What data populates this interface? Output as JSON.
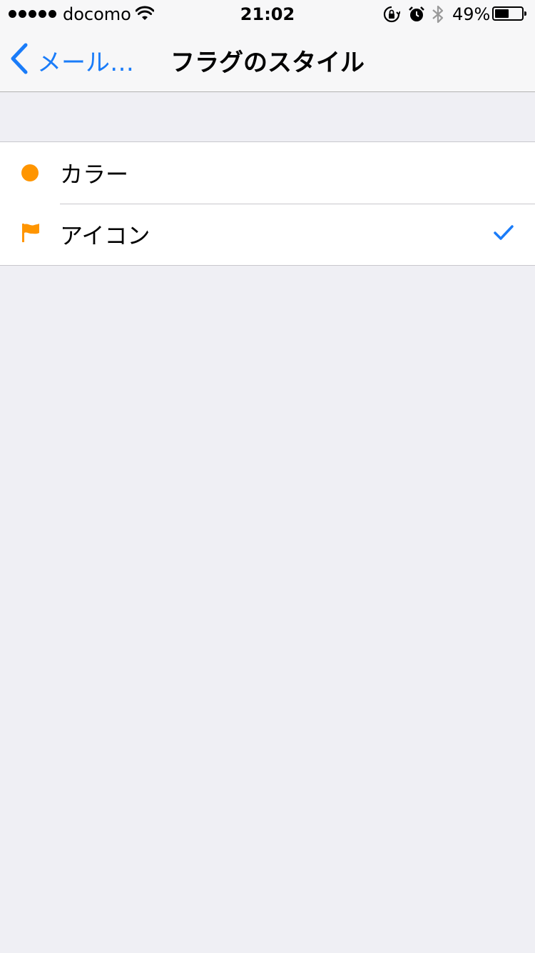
{
  "status_bar": {
    "carrier": "docomo",
    "time": "21:02",
    "battery_percent": "49%",
    "battery_level": 0.49,
    "signal_bars": 5
  },
  "nav": {
    "back_label": "メール…",
    "title": "フラグのスタイル"
  },
  "options": [
    {
      "label": "カラー",
      "icon": "circle-icon",
      "selected": false
    },
    {
      "label": "アイコン",
      "icon": "flag-icon",
      "selected": true
    }
  ],
  "colors": {
    "accent": "#1a7cf9",
    "flag": "#ff9500",
    "background": "#efeff4"
  }
}
